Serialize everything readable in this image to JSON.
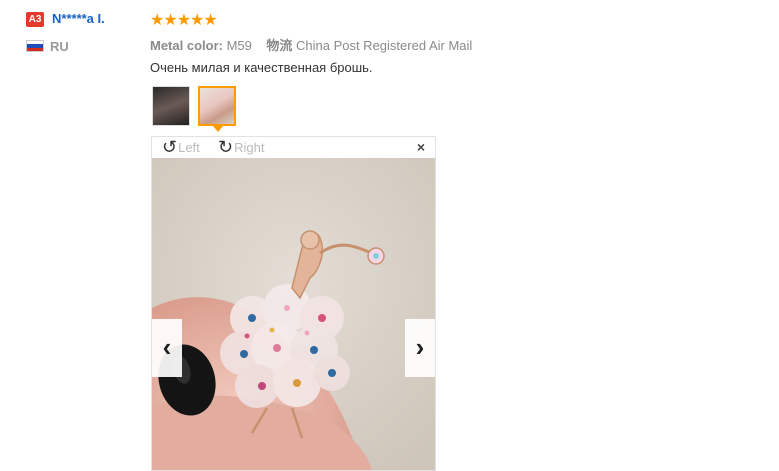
{
  "reviewer": {
    "badge": "A3",
    "name": "N*****a I.",
    "country": "RU",
    "flag_colors": [
      "#ffffff",
      "#1e4fb8",
      "#d52b1e"
    ]
  },
  "review": {
    "stars": "★★★★★",
    "color_label": "Metal color:",
    "color_value": "M59",
    "shipping_label": "物流",
    "shipping_value": "China Post Registered Air Mail",
    "text": "Очень милая и качественная брошь."
  },
  "viewer": {
    "rotate_left": "Left",
    "rotate_right": "Right",
    "close": "×",
    "prev": "‹",
    "next": "›"
  },
  "colors": {
    "accent": "#ff9a00",
    "badge": "#e4392b",
    "link": "#1a62c4"
  }
}
